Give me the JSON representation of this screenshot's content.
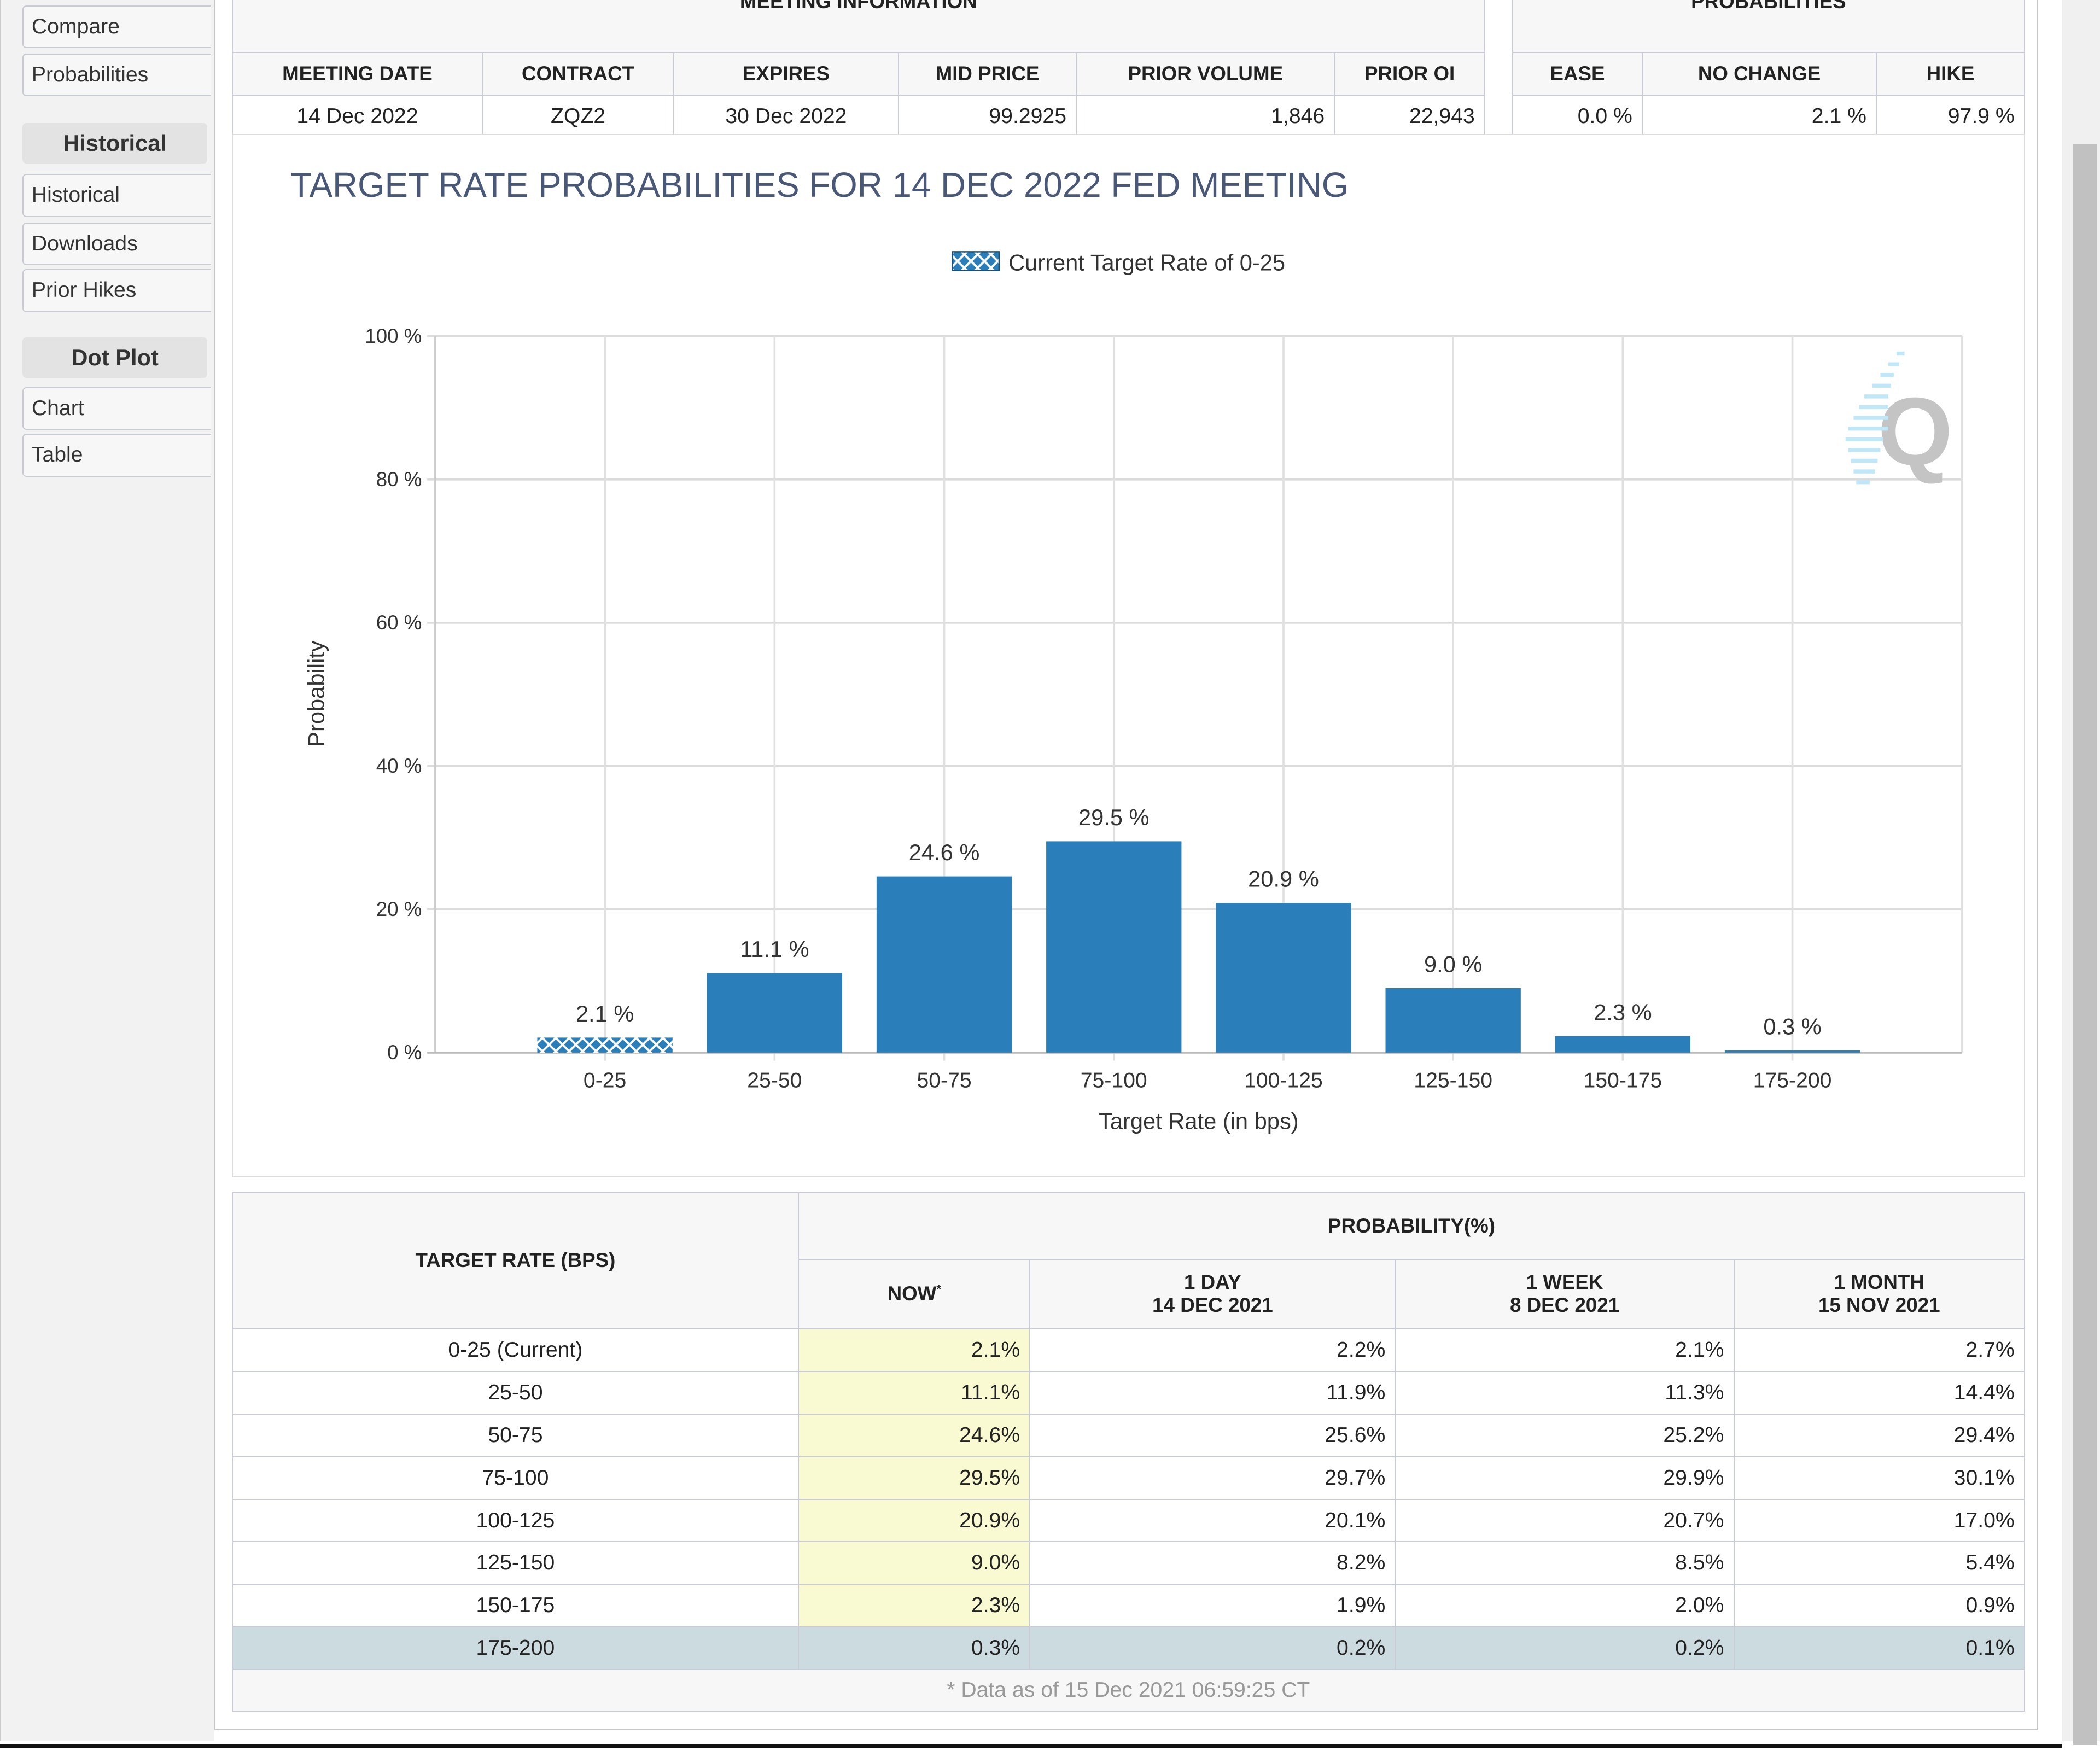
{
  "sidebar": {
    "items_top": [
      "Compare",
      "Probabilities"
    ],
    "historical_header": "Historical",
    "historical_items": [
      "Historical",
      "Downloads",
      "Prior Hikes"
    ],
    "dotplot_header": "Dot Plot",
    "dotplot_items": [
      "Chart",
      "Table"
    ]
  },
  "meeting_info": {
    "title": "MEETING INFORMATION",
    "headers": [
      "MEETING DATE",
      "CONTRACT",
      "EXPIRES",
      "MID PRICE",
      "PRIOR VOLUME",
      "PRIOR OI"
    ],
    "row": [
      "14 Dec 2022",
      "ZQZ2",
      "30 Dec 2022",
      "99.2925",
      "1,846",
      "22,943"
    ]
  },
  "probabilities": {
    "title": "PROBABILITIES",
    "headers": [
      "EASE",
      "NO CHANGE",
      "HIKE"
    ],
    "row": [
      "0.0 %",
      "2.1 %",
      "97.9 %"
    ]
  },
  "chart_data": {
    "type": "bar",
    "title": "TARGET RATE PROBABILITIES FOR 14 DEC 2022 FED MEETING",
    "legend": "Current Target Rate of 0-25",
    "legend_placement": "top",
    "xlabel": "Target Rate (in bps)",
    "ylabel": "Probability",
    "categories": [
      "0-25",
      "25-50",
      "50-75",
      "75-100",
      "100-125",
      "125-150",
      "150-175",
      "175-200"
    ],
    "values": [
      2.1,
      11.1,
      24.6,
      29.5,
      20.9,
      9.0,
      2.3,
      0.3
    ],
    "data_labels": [
      "2.1 %",
      "11.1 %",
      "24.6 %",
      "29.5 %",
      "20.9 %",
      "9.0 %",
      "2.3 %",
      "0.3 %"
    ],
    "yticks": [
      "0 %",
      "20 %",
      "40 %",
      "60 %",
      "80 %",
      "100 %"
    ],
    "ylim": [
      0,
      100
    ],
    "grid": true,
    "bar_color": "#2a7fba",
    "current_bar_pattern": "crosshatch"
  },
  "prob_table": {
    "rate_header": "TARGET RATE (BPS)",
    "prob_header": "PROBABILITY(%)",
    "columns": [
      {
        "l1": "NOW",
        "l2": "",
        "mark": "*"
      },
      {
        "l1": "1 DAY",
        "l2": "14 DEC 2021"
      },
      {
        "l1": "1 WEEK",
        "l2": "8 DEC 2021"
      },
      {
        "l1": "1 MONTH",
        "l2": "15 NOV 2021"
      }
    ],
    "rows": [
      [
        "0-25 (Current)",
        "2.1%",
        "2.2%",
        "2.1%",
        "2.7%"
      ],
      [
        "25-50",
        "11.1%",
        "11.9%",
        "11.3%",
        "14.4%"
      ],
      [
        "50-75",
        "24.6%",
        "25.6%",
        "25.2%",
        "29.4%"
      ],
      [
        "75-100",
        "29.5%",
        "29.7%",
        "29.9%",
        "30.1%"
      ],
      [
        "100-125",
        "20.9%",
        "20.1%",
        "20.7%",
        "17.0%"
      ],
      [
        "125-150",
        "9.0%",
        "8.2%",
        "8.5%",
        "5.4%"
      ],
      [
        "150-175",
        "2.3%",
        "1.9%",
        "2.0%",
        "0.9%"
      ],
      [
        "175-200",
        "0.3%",
        "0.2%",
        "0.2%",
        "0.1%"
      ]
    ],
    "footnote": "* Data as of 15 Dec 2021 06:59:25 CT"
  }
}
